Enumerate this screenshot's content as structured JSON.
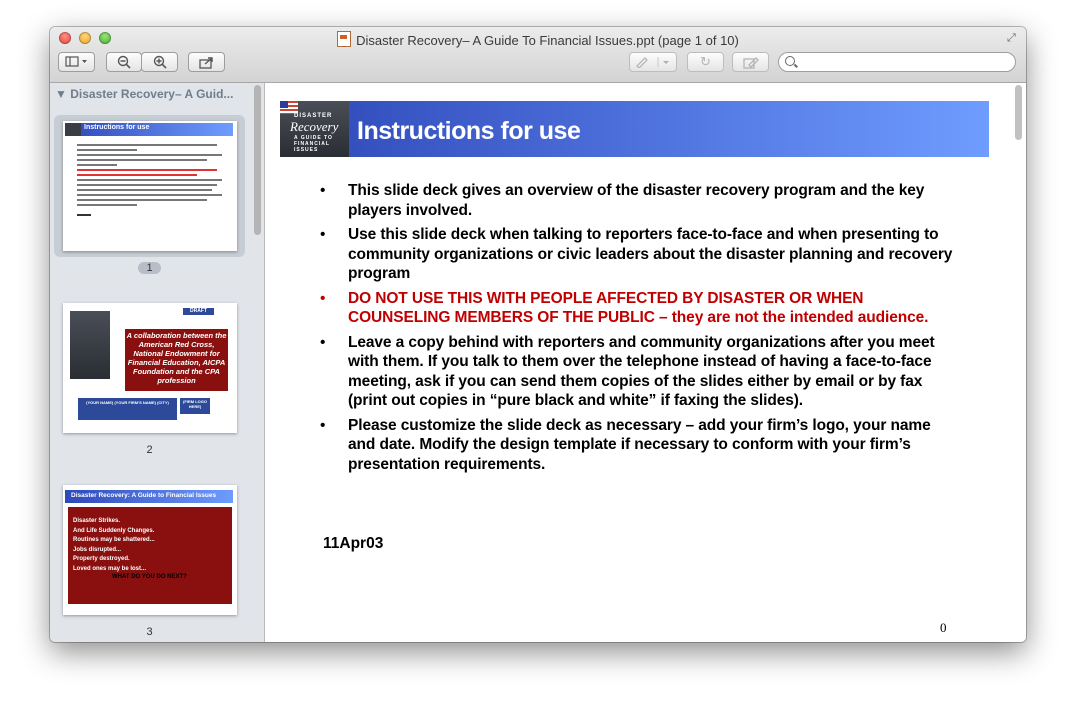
{
  "window": {
    "title": "Disaster Recovery– A Guide To Financial Issues.ppt (page 1 of 10)"
  },
  "toolbar": {
    "search_value": "",
    "redo_glyph": "↻"
  },
  "sidebar": {
    "header": "Disaster Recovery– A Guid...",
    "pages": [
      {
        "number": "1",
        "title": "Instructions for use"
      },
      {
        "number": "2",
        "draft": "DRAFT",
        "collab": "A collaboration between the American Red Cross, National Endowment for Financial Education, AICPA Foundation and the CPA profession",
        "name_box": "(YOUR NAME) (YOUR FIRM'S NAME) (CITY)",
        "logo_box": "(FIRM LOGO HERE)"
      },
      {
        "number": "3",
        "title": "Disaster Recovery: A Guide to Financial Issues",
        "lines": [
          "Disaster Strikes.",
          "And Life Suddenly Changes.",
          "Routines may be shattered...",
          "Jobs disrupted...",
          "Property destroyed.",
          "Loved ones may be lost..."
        ],
        "question": "WHAT DO YOU DO NEXT?"
      }
    ]
  },
  "slide": {
    "logo_top": "DISASTER",
    "logo_main": "Recovery",
    "logo_sub": "A GUIDE TO FINANCIAL ISSUES",
    "title": "Instructions for use",
    "bullets": [
      "This slide deck gives an overview of the disaster recovery program and the key players involved.",
      "Use this slide deck when talking to reporters face-to-face and when presenting to community organizations or civic leaders about the disaster planning and recovery program",
      "DO NOT USE THIS WITH PEOPLE AFFECTED BY DISASTER OR WHEN COUNSELING MEMBERS OF THE PUBLIC – they are not the intended audience.",
      "Leave a copy behind with reporters and community organizations after you meet with them.  If you talk to them over the telephone instead of having a face-to-face meeting, ask if you can send them copies of the slides either by email or by fax (print out copies in “pure black and white” if faxing the slides).",
      "Please customize the slide deck as necessary – add your firm’s logo, your name and date.  Modify the design template if necessary to conform with your firm’s presentation requirements."
    ],
    "date": "11Apr03",
    "slide_number": "0"
  }
}
